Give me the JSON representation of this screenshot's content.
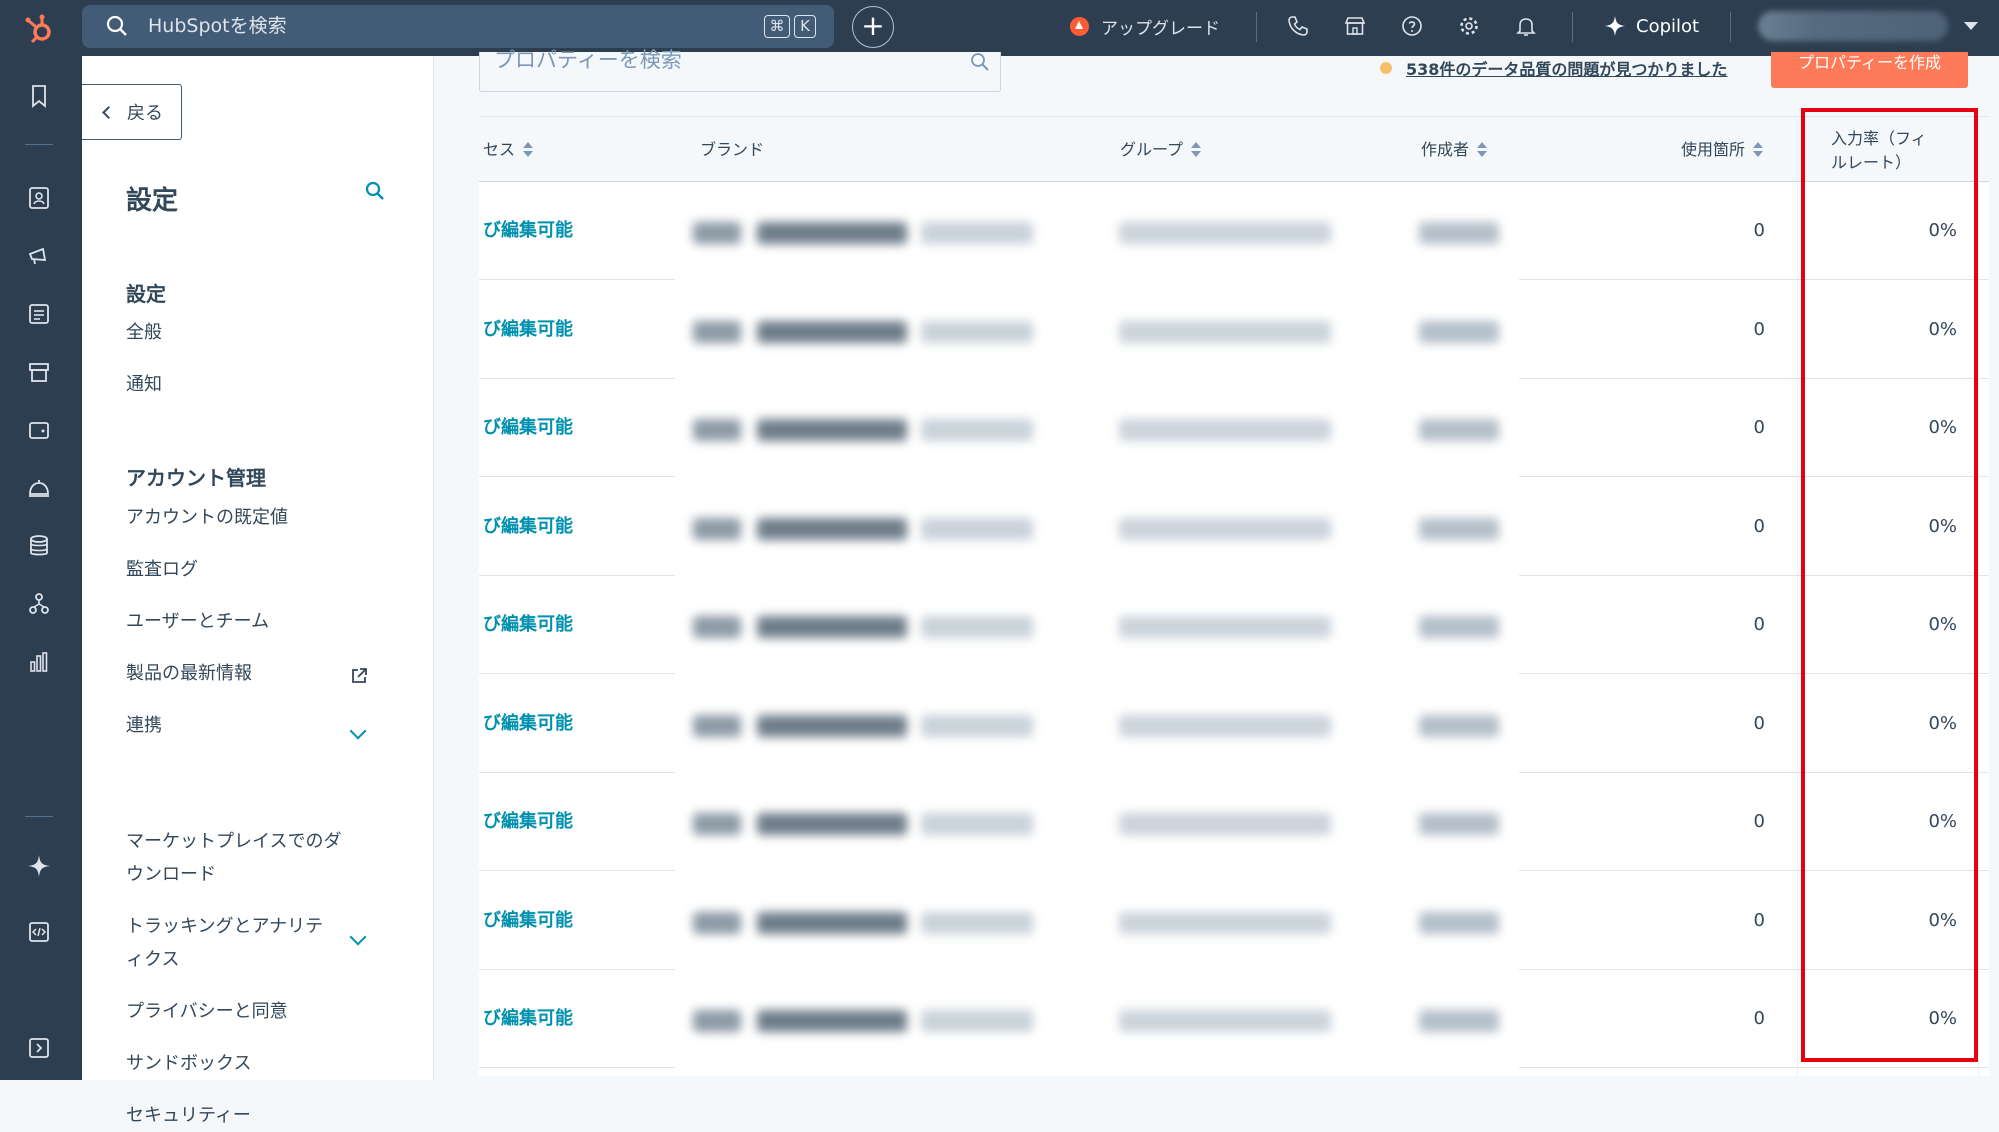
{
  "topbar": {
    "search_placeholder": "HubSpotを検索",
    "kbd_cmd": "⌘",
    "kbd_k": "K",
    "add_symbol": "+",
    "upgrade_label": "アップグレード",
    "copilot_label": "Copilot",
    "icons": [
      "phone-icon",
      "marketplace-icon",
      "help-icon",
      "settings-gear-icon",
      "notifications-bell-icon"
    ]
  },
  "settings_sidebar": {
    "back_label": "戻る",
    "title": "設定",
    "section_settings": "設定",
    "items_settings": [
      "全般",
      "通知"
    ],
    "section_account": "アカウント管理",
    "items_account": [
      "アカウントの既定値",
      "監査ログ",
      "ユーザーとチーム",
      "製品の最新情報",
      "連携",
      "マーケットプレイスでのダ",
      "ウンロード",
      "トラッキングとアナリテ",
      "ィクス",
      "プライバシーと同意",
      "サンドボックス",
      "セキュリティー"
    ]
  },
  "toolbar": {
    "property_search_placeholder": "プロパティーを検索",
    "data_quality_link": "538件のデータ品質の問題が見つかりました",
    "create_property_label": "プロパティーを作成"
  },
  "table": {
    "columns": {
      "access": "セス",
      "brand": "ブランド",
      "group": "グループ",
      "creator": "作成者",
      "usage": "使用箇所",
      "fill_rate_line1": "入力率（フィ",
      "fill_rate_line2": "ルレート）"
    },
    "rows": [
      {
        "access": "び編集可能",
        "usage": "0",
        "fill_rate": "0%"
      },
      {
        "access": "び編集可能",
        "usage": "0",
        "fill_rate": "0%"
      },
      {
        "access": "び編集可能",
        "usage": "0",
        "fill_rate": "0%"
      },
      {
        "access": "び編集可能",
        "usage": "0",
        "fill_rate": "0%"
      },
      {
        "access": "び編集可能",
        "usage": "0",
        "fill_rate": "0%"
      },
      {
        "access": "び編集可能",
        "usage": "0",
        "fill_rate": "0%"
      },
      {
        "access": "び編集可能",
        "usage": "0",
        "fill_rate": "0%"
      },
      {
        "access": "び編集可能",
        "usage": "0",
        "fill_rate": "0%"
      },
      {
        "access": "び編集可能",
        "usage": "0",
        "fill_rate": "0%"
      }
    ]
  },
  "colors": {
    "topbar_bg": "#2d3e50",
    "accent_orange": "#ff7a59",
    "link_teal": "#0091ae",
    "highlight_red": "#e60012"
  }
}
